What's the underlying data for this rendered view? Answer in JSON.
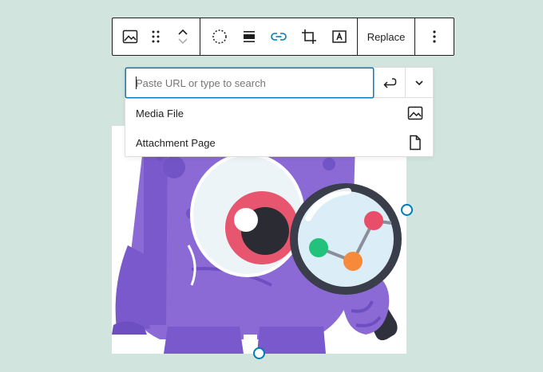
{
  "colors": {
    "background": "#d1e4dd",
    "accent": "#007cba",
    "text": "#1e1e1e",
    "placeholder": "#757575",
    "border": "#dddddd"
  },
  "toolbar": {
    "groups": [
      {
        "items": [
          "image-icon",
          "drag-handle-icon",
          "move-up-down-icon"
        ]
      },
      {
        "items": [
          "duotone-icon",
          "align-icon",
          "link-icon",
          "crop-icon",
          "text-overlay-icon"
        ]
      },
      {
        "items": [
          "replace-button"
        ]
      },
      {
        "items": [
          "more-options-icon"
        ]
      }
    ],
    "replace_label": "Replace",
    "active_item": "link-icon"
  },
  "link_popover": {
    "search": {
      "placeholder": "Paste URL or type to search",
      "value": ""
    },
    "submit_icon": "return-arrow-icon",
    "expand_icon": "chevron-down-icon",
    "options": [
      {
        "label": "Media File",
        "icon": "image-icon"
      },
      {
        "label": "Attachment Page",
        "icon": "page-icon"
      }
    ]
  },
  "image": {
    "subject": "purple monster mascot holding a magnifying glass over a line graph",
    "palette": {
      "body": "#8b6ad6",
      "body_dark": "#6e4fc2",
      "glass_rim": "#3a3d4a",
      "lens": "#dbeef7",
      "dot_red": "#e84d6a",
      "dot_green": "#22c27c",
      "dot_orange": "#f58a3a",
      "eye_iris": "#e8556f"
    }
  }
}
